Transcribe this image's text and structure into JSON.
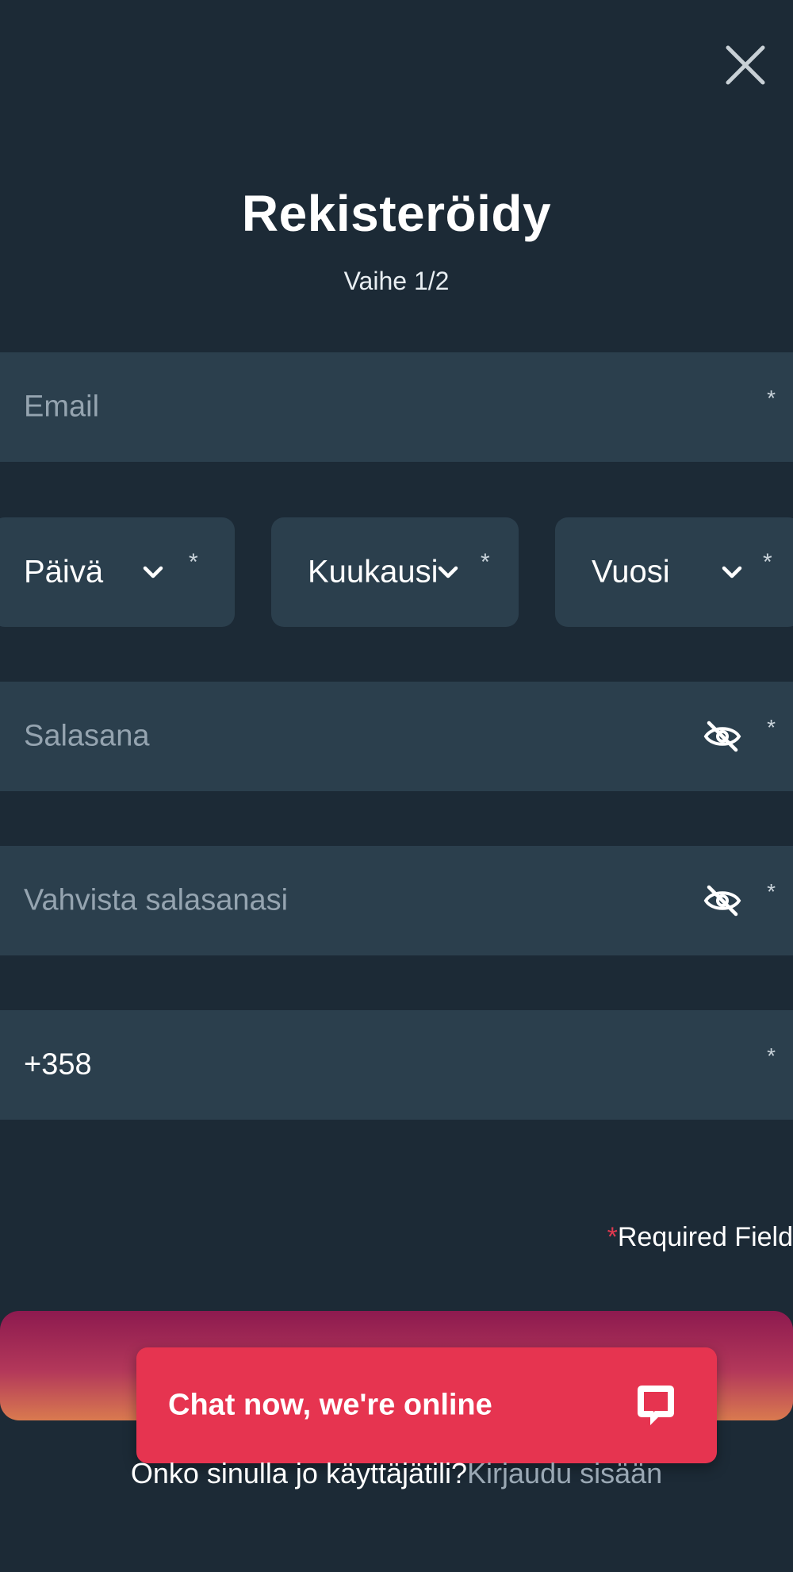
{
  "header": {
    "close_icon": "close-icon",
    "title": "Rekisteröidy",
    "step": "Vaihe 1/2"
  },
  "form": {
    "email": {
      "placeholder": "Email",
      "required_mark": "*"
    },
    "birthdate": {
      "day": {
        "label": "Päivä",
        "required_mark": "*"
      },
      "month": {
        "label": "Kuukausi",
        "required_mark": "*"
      },
      "year": {
        "label": "Vuosi",
        "required_mark": "*"
      }
    },
    "password": {
      "placeholder": "Salasana",
      "required_mark": "*",
      "icon": "eye-off-icon"
    },
    "confirm_password": {
      "placeholder": "Vahvista salasanasi",
      "required_mark": "*",
      "icon": "eye-off-icon"
    },
    "phone": {
      "value": "+358",
      "required_mark": "*"
    },
    "required_note": {
      "star": "*",
      "text": "Required Field"
    }
  },
  "chat": {
    "text": "Chat now, we're online",
    "icon": "chat-bubble-icon"
  },
  "footer": {
    "question": "Onko sinulla jo käyttäjätili?",
    "login_link": "Kirjaudu sisään"
  },
  "colors": {
    "background": "#1c2a36",
    "field": "#2b3f4d",
    "chat": "#e63450",
    "required_star": "#e0394f"
  }
}
